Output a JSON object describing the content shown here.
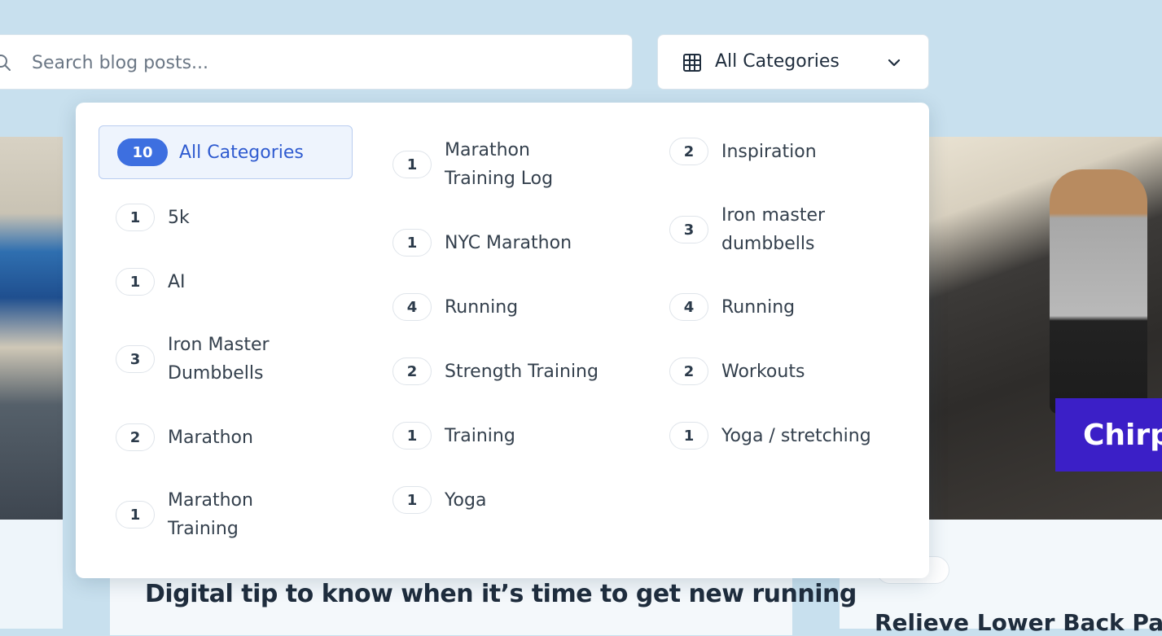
{
  "search": {
    "placeholder": "Search blog posts..."
  },
  "category_select": {
    "label": "All Categories"
  },
  "dropdown": {
    "selected": {
      "count": "10",
      "label": "All Categories"
    },
    "columns": [
      [
        {
          "count": "1",
          "label": "5k"
        },
        {
          "count": "1",
          "label": "AI"
        },
        {
          "count": "3",
          "label": "Iron Master Dumbbells"
        },
        {
          "count": "2",
          "label": "Marathon"
        },
        {
          "count": "1",
          "label": "Marathon Training"
        }
      ],
      [
        {
          "count": "1",
          "label": "Marathon Training Log"
        },
        {
          "count": "1",
          "label": "NYC Marathon"
        },
        {
          "count": "4",
          "label": "Running"
        },
        {
          "count": "2",
          "label": "Strength Training"
        },
        {
          "count": "1",
          "label": "Training"
        },
        {
          "count": "1",
          "label": "Yoga"
        }
      ],
      [
        {
          "count": "2",
          "label": "Inspiration"
        },
        {
          "count": "3",
          "label": "Iron master dumbbells"
        },
        {
          "count": "4",
          "label": "Running"
        },
        {
          "count": "2",
          "label": "Workouts"
        },
        {
          "count": "1",
          "label": "Yoga / stretching"
        }
      ]
    ]
  },
  "background": {
    "center_post_title": "Digital tip to know when it’s time to get new running",
    "right_post_title": "Relieve Lower Back Pain",
    "right_image_banner": "Chirp"
  },
  "colors": {
    "accent": "#3d6fe0",
    "page_bg": "#c8e0ee",
    "selected_bg": "#eef4fd"
  }
}
